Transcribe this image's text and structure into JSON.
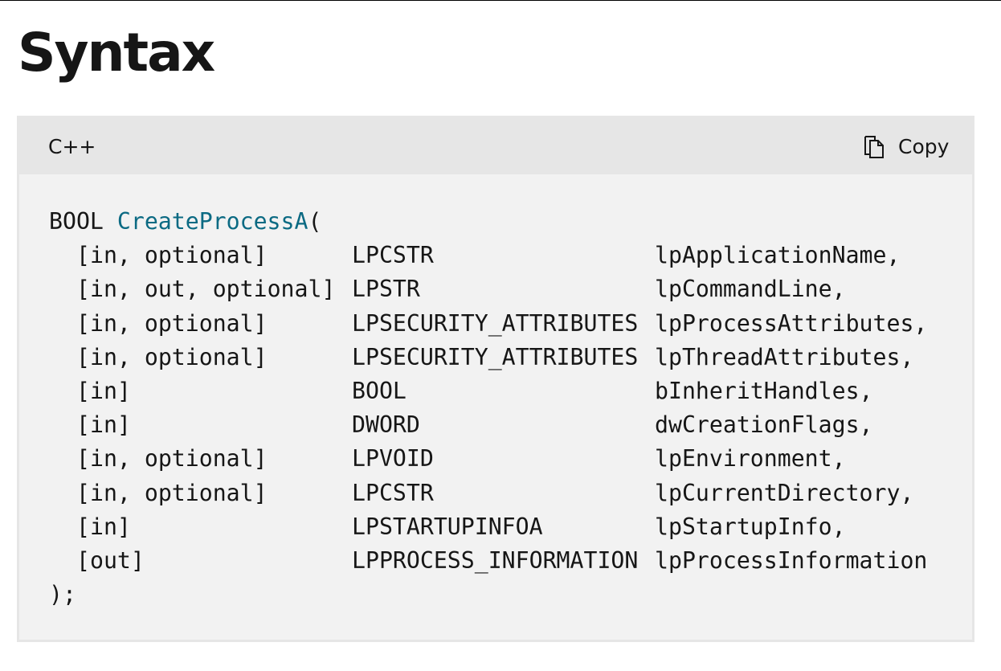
{
  "heading": "Syntax",
  "code_block": {
    "language": "C++",
    "copy_label": "Copy",
    "copy_icon": "copy-icon",
    "function_return_type": "BOOL",
    "function_name": "CreateProcessA",
    "open_paren": "(",
    "close": ");",
    "parameters": [
      {
        "annotation": "[in, optional]",
        "type": "LPCSTR",
        "name": "lpApplicationName,"
      },
      {
        "annotation": "[in, out, optional]",
        "type": "LPSTR",
        "name": "lpCommandLine,"
      },
      {
        "annotation": "[in, optional]",
        "type": "LPSECURITY_ATTRIBUTES",
        "name": "lpProcessAttributes,"
      },
      {
        "annotation": "[in, optional]",
        "type": "LPSECURITY_ATTRIBUTES",
        "name": "lpThreadAttributes,"
      },
      {
        "annotation": "[in]",
        "type": "BOOL",
        "name": "bInheritHandles,"
      },
      {
        "annotation": "[in]",
        "type": "DWORD",
        "name": "dwCreationFlags,"
      },
      {
        "annotation": "[in, optional]",
        "type": "LPVOID",
        "name": "lpEnvironment,"
      },
      {
        "annotation": "[in, optional]",
        "type": "LPCSTR",
        "name": "lpCurrentDirectory,"
      },
      {
        "annotation": "[in]",
        "type": "LPSTARTUPINFOA",
        "name": "lpStartupInfo,"
      },
      {
        "annotation": "[out]",
        "type": "LPPROCESS_INFORMATION",
        "name": "lpProcessInformation"
      }
    ]
  },
  "colors": {
    "function_name": "#0b6a83",
    "code_background": "#f2f2f2",
    "header_background": "#e6e6e6",
    "text": "#161616"
  }
}
